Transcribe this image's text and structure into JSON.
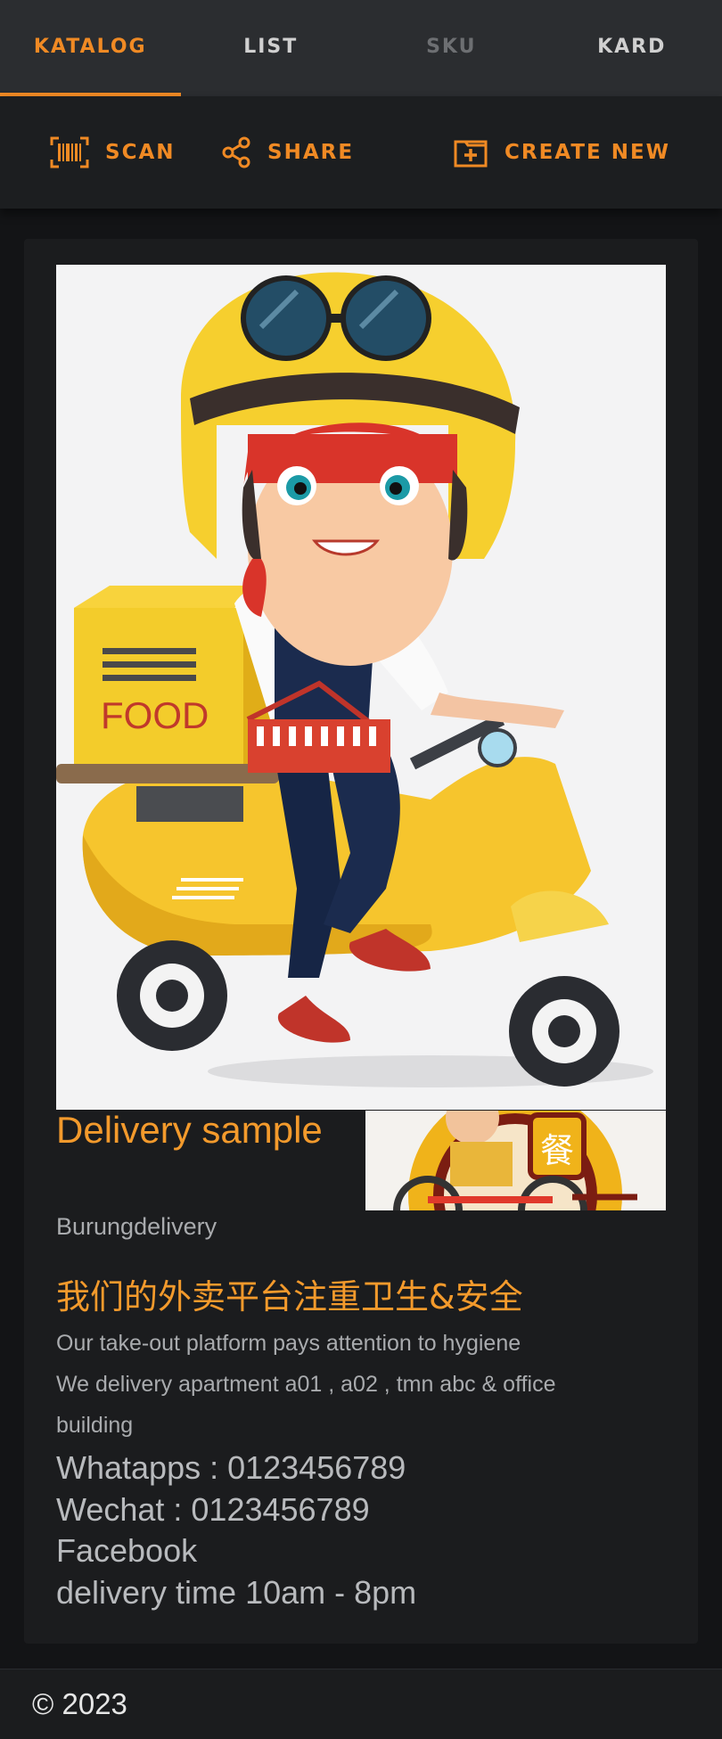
{
  "tabs": [
    {
      "label": "KATALOG"
    },
    {
      "label": "LIST"
    },
    {
      "label": "SKU"
    },
    {
      "label": "KARD"
    }
  ],
  "toolbar": {
    "scan_label": "SCAN",
    "share_label": "SHARE",
    "create_label": "CREATE NEW"
  },
  "colors": {
    "accent": "#f08a24",
    "background": "#131416",
    "card": "#1b1c1e"
  },
  "product": {
    "title": "Delivery sample",
    "subtitle": "Burungdelivery",
    "heading": "我们的外卖平台注重卫生&安全",
    "description_lines": [
      "Our take-out platform pays attention to hygiene",
      "We delivery apartment a01 , a02 , tmn abc & office building"
    ],
    "contact_lines": [
      "Whatapps : 0123456789",
      "Wechat : 0123456789",
      "Facebook",
      "delivery time 10am - 8pm"
    ],
    "hero_text": "FOOD",
    "thumb_text": "餐"
  },
  "footer": {
    "copyright": "© 2023"
  }
}
